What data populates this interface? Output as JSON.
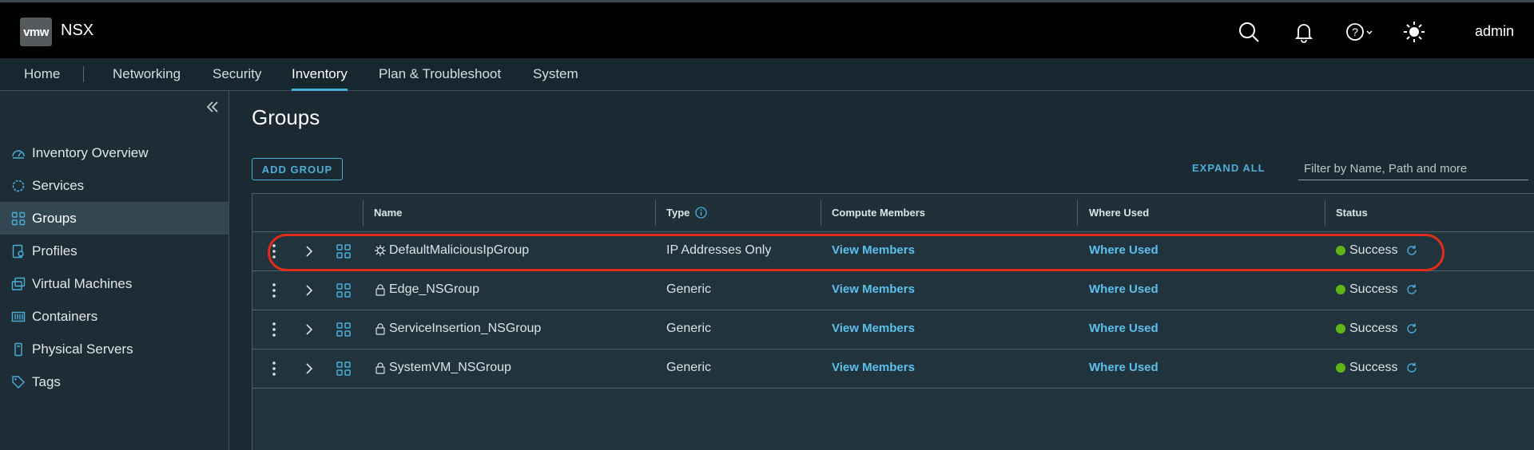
{
  "header": {
    "logo": "vmw",
    "app_name": "NSX",
    "user": "admin"
  },
  "nav": {
    "items": [
      {
        "label": "Home"
      },
      {
        "label": "Networking"
      },
      {
        "label": "Security"
      },
      {
        "label": "Inventory",
        "active": true
      },
      {
        "label": "Plan & Troubleshoot"
      },
      {
        "label": "System"
      }
    ]
  },
  "sidebar": {
    "items": [
      {
        "label": "Inventory Overview",
        "icon": "dashboard-icon"
      },
      {
        "label": "Services",
        "icon": "services-icon"
      },
      {
        "label": "Groups",
        "icon": "groups-icon",
        "active": true
      },
      {
        "label": "Profiles",
        "icon": "profiles-icon"
      },
      {
        "label": "Virtual Machines",
        "icon": "vm-icon"
      },
      {
        "label": "Containers",
        "icon": "containers-icon"
      },
      {
        "label": "Physical Servers",
        "icon": "server-icon"
      },
      {
        "label": "Tags",
        "icon": "tag-icon"
      }
    ]
  },
  "page": {
    "title": "Groups",
    "add_button": "ADD GROUP",
    "expand_all": "EXPAND ALL",
    "filter_placeholder": "Filter by Name, Path and more"
  },
  "table": {
    "columns": [
      "Name",
      "Type",
      "Compute Members",
      "Where Used",
      "Status"
    ],
    "rows": [
      {
        "name": "DefaultMaliciousIpGroup",
        "name_icon": "malicious-icon",
        "type": "IP Addresses Only",
        "members": "View Members",
        "where_used": "Where Used",
        "status": "Success"
      },
      {
        "name": "Edge_NSGroup",
        "name_icon": "lock-icon",
        "type": "Generic",
        "members": "View Members",
        "where_used": "Where Used",
        "status": "Success"
      },
      {
        "name": "ServiceInsertion_NSGroup",
        "name_icon": "lock-icon",
        "type": "Generic",
        "members": "View Members",
        "where_used": "Where Used",
        "status": "Success"
      },
      {
        "name": "SystemVM_NSGroup",
        "name_icon": "lock-icon",
        "type": "Generic",
        "members": "View Members",
        "where_used": "Where Used",
        "status": "Success"
      }
    ]
  },
  "colors": {
    "accent": "#49afd9",
    "link": "#5cc0ec",
    "success": "#5eb715",
    "highlight": "#e02d1b"
  }
}
